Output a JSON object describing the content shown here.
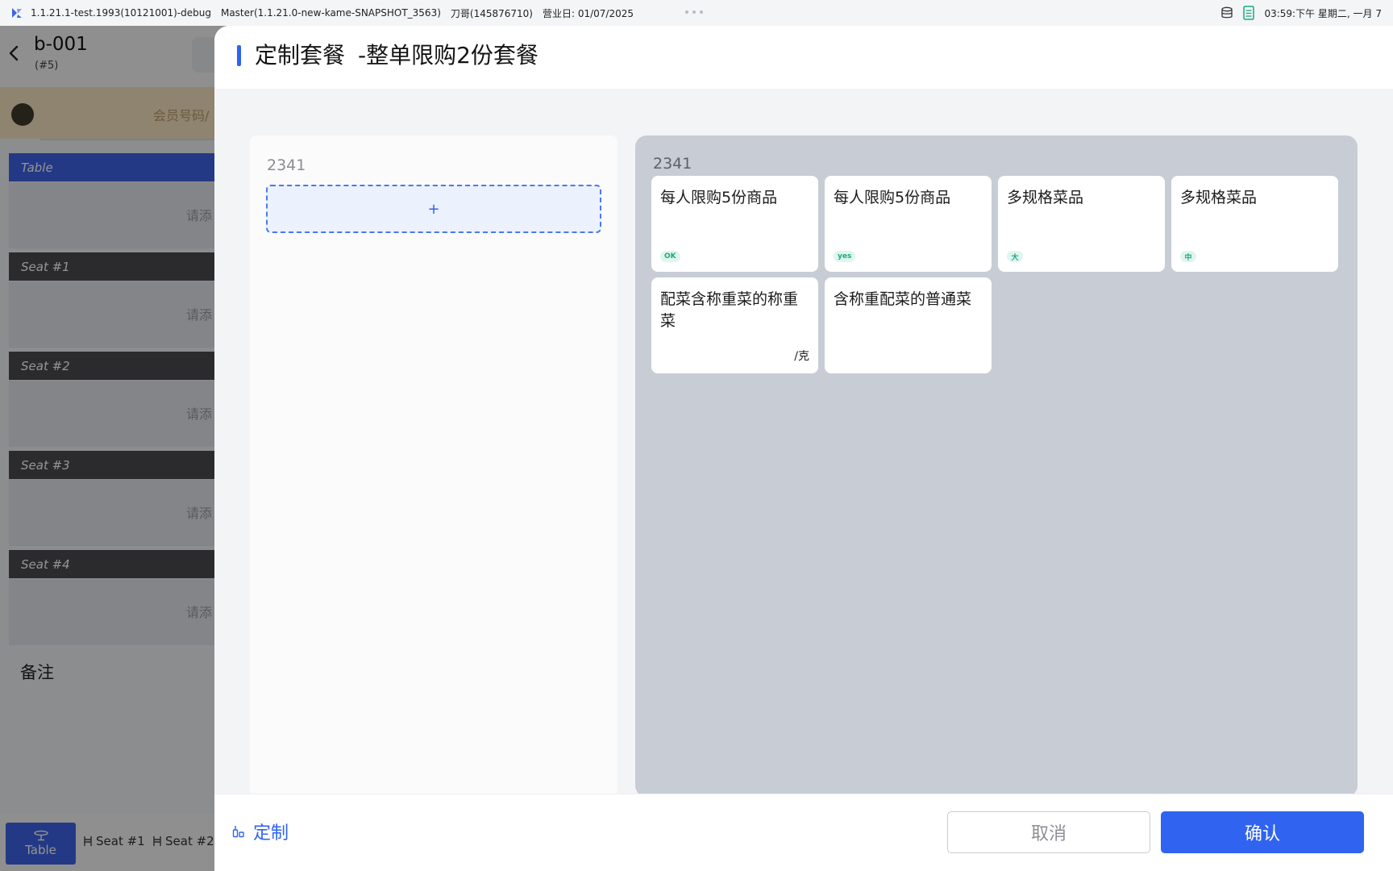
{
  "status_bar": {
    "version": "1.1.21.1-test.1993(10121001)-debug",
    "master": "Master(1.1.21.0-new-kame-SNAPSHOT_3563)",
    "user": "刀哥(145876710)",
    "business_day": "营业日: 01/07/2025",
    "clock": "03:59:下午 星期二, 一月 7"
  },
  "background_order": {
    "table_name": "b-001",
    "table_sub": "(#5)",
    "member_placeholder": "会员号码/",
    "sections": [
      {
        "header": "Table",
        "placeholder": "请添"
      },
      {
        "header": "Seat #1",
        "placeholder": "请添"
      },
      {
        "header": "Seat #2",
        "placeholder": "请添"
      },
      {
        "header": "Seat #3",
        "placeholder": "请添"
      },
      {
        "header": "Seat #4",
        "placeholder": "请添"
      }
    ],
    "remark_label": "备注",
    "bottom_tabs": [
      "Table",
      "Seat #1",
      "Seat #2"
    ]
  },
  "modal": {
    "title": "定制套餐",
    "subtitle": "-整单限购2份套餐",
    "left_group_label": "2341",
    "add_symbol": "+",
    "right_group_label": "2341",
    "items": [
      {
        "name": "每人限购5份商品",
        "tag": "OK",
        "unit": ""
      },
      {
        "name": "每人限购5份商品",
        "tag": "yes",
        "unit": ""
      },
      {
        "name": "多规格菜品",
        "tag": "大",
        "unit": ""
      },
      {
        "name": "多规格菜品",
        "tag": "中",
        "unit": ""
      },
      {
        "name": "配菜含称重菜的称重菜",
        "tag": "",
        "unit": "/克"
      },
      {
        "name": "含称重配菜的普通菜",
        "tag": "",
        "unit": ""
      }
    ],
    "footer": {
      "custom_label": "定制",
      "cancel_label": "取消",
      "confirm_label": "确认"
    }
  },
  "colors": {
    "accent": "#2f63f0",
    "tag_bg": "#dff5ee",
    "tag_text": "#1aa884",
    "seat_header": "#4a4b4e",
    "member_bar": "#f6e3bf"
  }
}
